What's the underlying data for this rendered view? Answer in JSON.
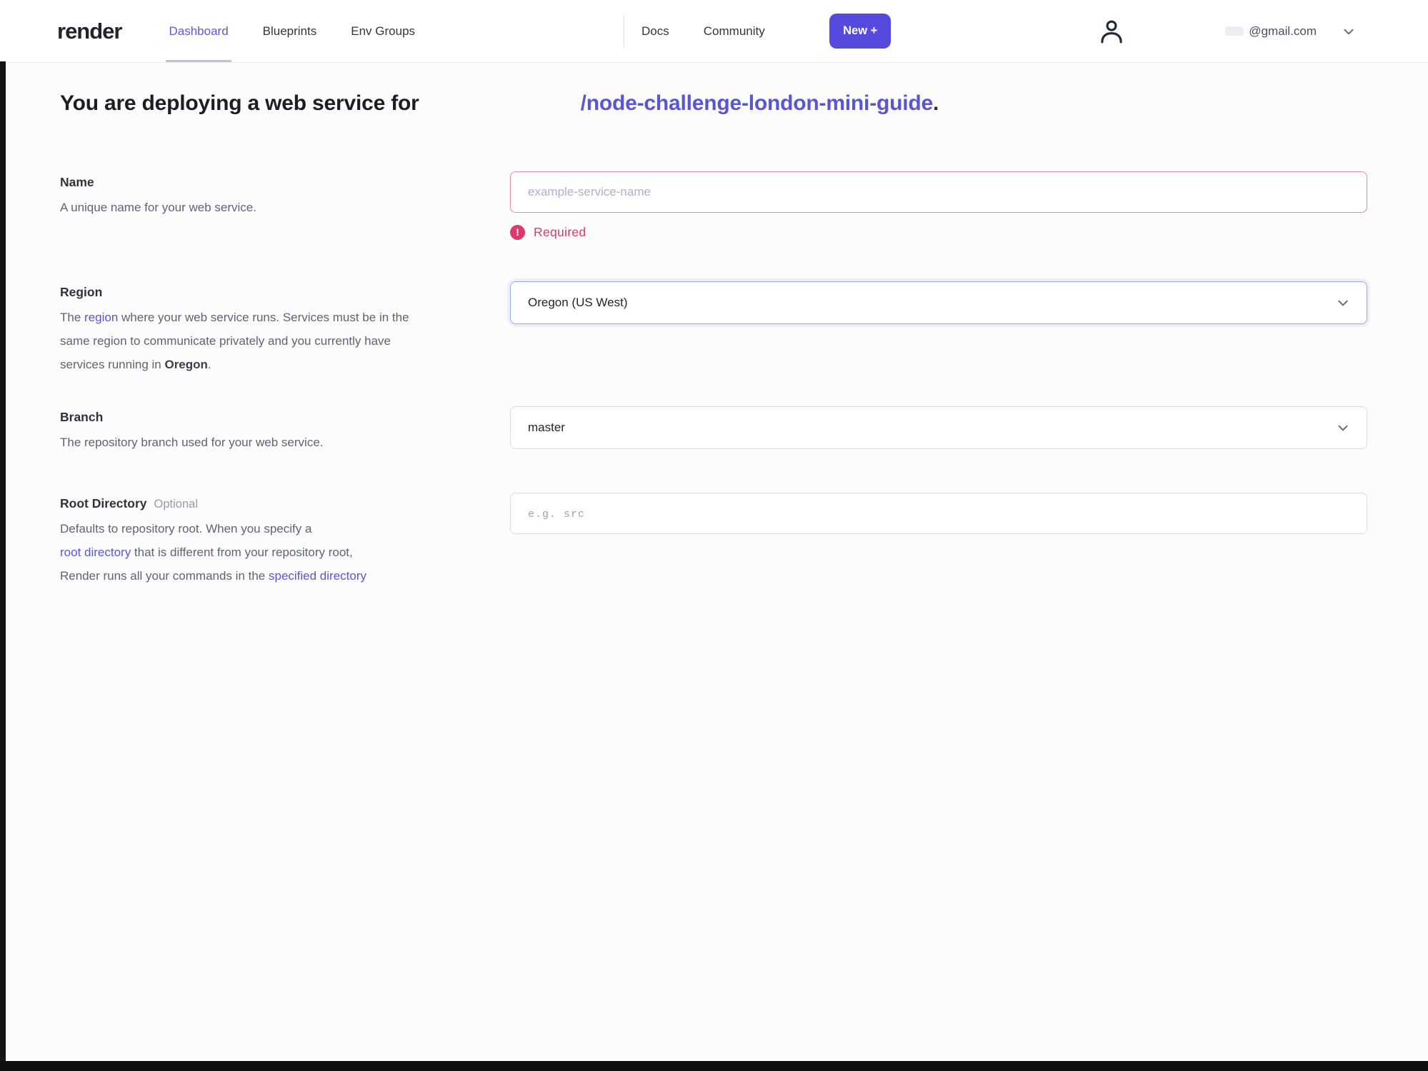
{
  "header": {
    "logo": "render",
    "nav": {
      "dashboard": "Dashboard",
      "blueprints": "Blueprints",
      "env_groups": "Env Groups",
      "docs": "Docs",
      "community": "Community"
    },
    "new_button_label": "New +",
    "account": {
      "email": "@gmail.com"
    }
  },
  "heading": {
    "prefix": "You are deploying a web service for",
    "repo_link": "/node-challenge-london-mini-guide",
    "suffix": "."
  },
  "form": {
    "name": {
      "label": "Name",
      "description": "A unique name for your web service.",
      "placeholder": "example-service-name",
      "error": "Required",
      "error_icon_glyph": "!"
    },
    "region": {
      "label": "Region",
      "desc_pre": "The ",
      "desc_link": "region",
      "desc_mid": " where your web service runs. Services must be in the same region to communicate privately and you currently have services running in ",
      "desc_bold": "Oregon",
      "desc_end": ".",
      "value": "Oregon (US West)"
    },
    "branch": {
      "label": "Branch",
      "description": "The repository branch used for your web service.",
      "value": "master"
    },
    "root_directory": {
      "label": "Root Directory",
      "optional_tag": "Optional",
      "desc_line1": "Defaults to repository root. When you specify a",
      "desc_link1": "root directory",
      "desc_line2_rest": " that is different from your repository root,",
      "desc_line3": "Render runs all your commands in the ",
      "desc_link2": "specified directory",
      "placeholder": "e.g. src"
    }
  },
  "colors": {
    "accent_purple": "#5a54d9",
    "error_rose": "#e0386a",
    "new_button_bg": "#5649de"
  }
}
